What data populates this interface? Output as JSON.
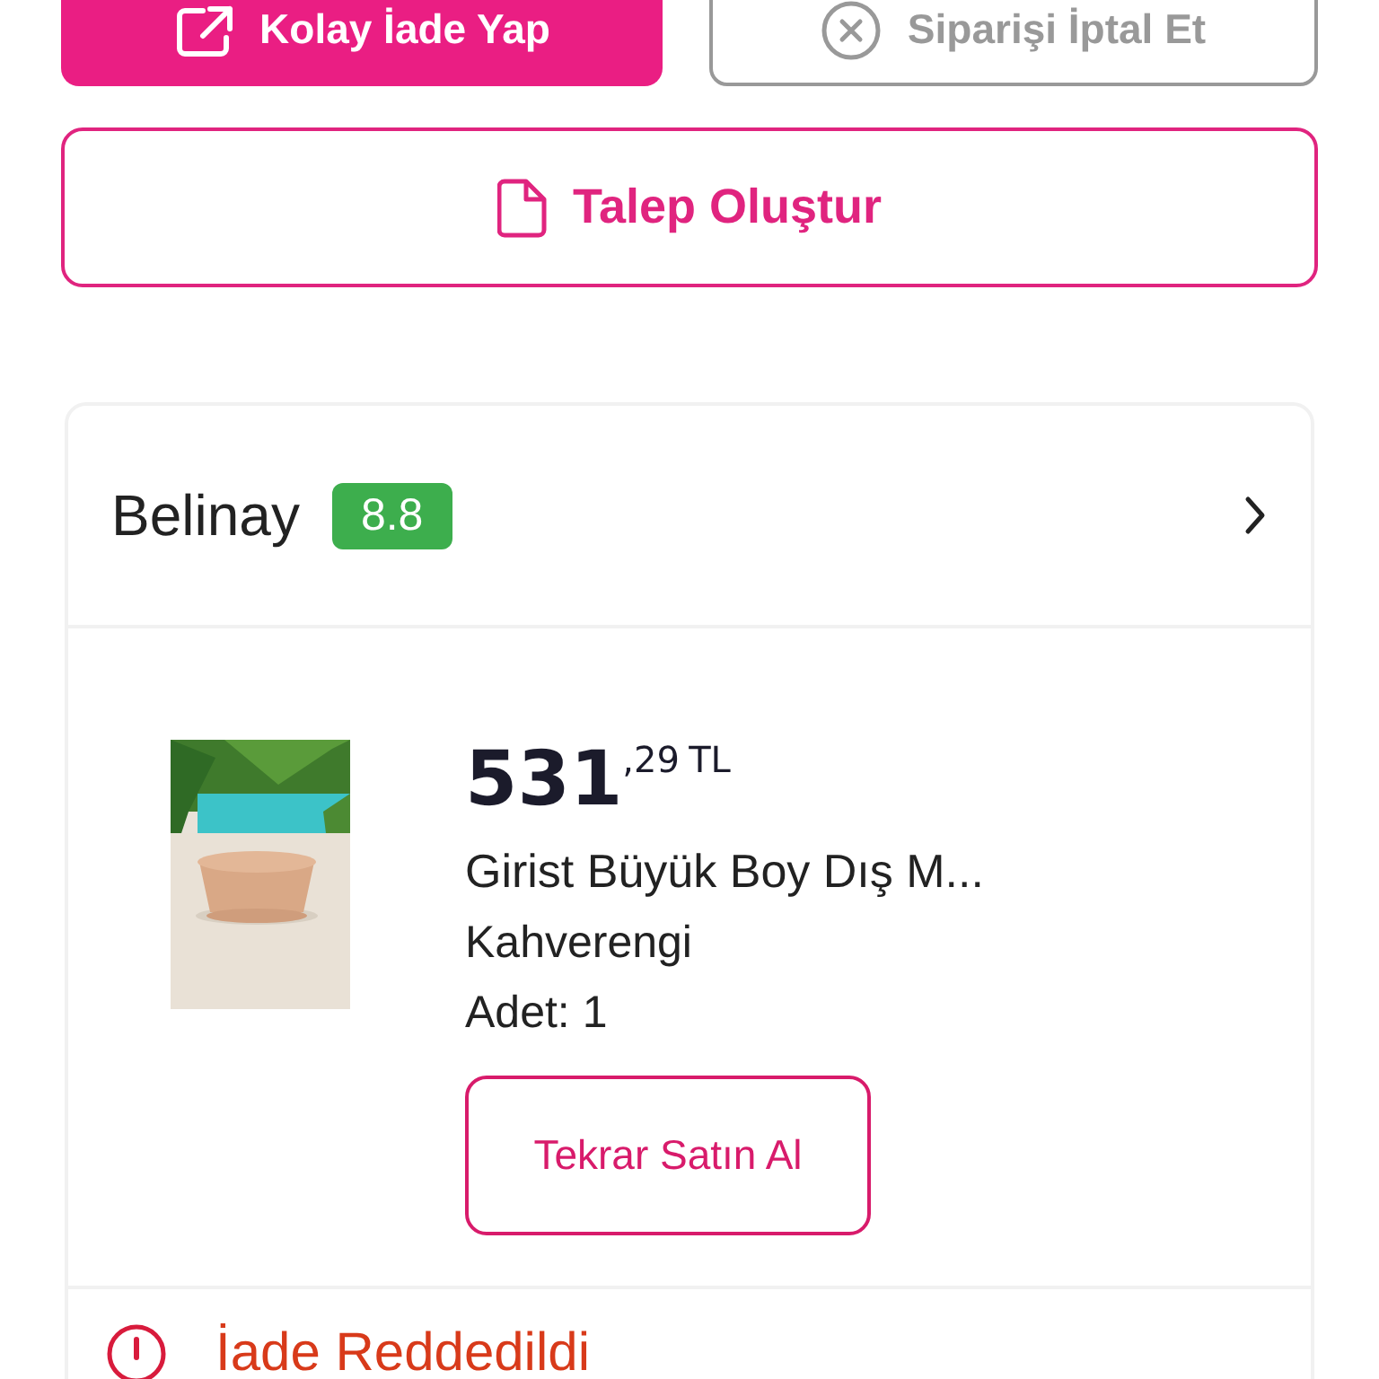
{
  "actions": [
    {
      "kind": "primary",
      "label": "Kolay İade Yap"
    },
    {
      "kind": "secondary",
      "label": "Siparişi İptal Et"
    }
  ],
  "request_button": {
    "label": "Talep Oluştur"
  },
  "seller": {
    "name": "Belinay",
    "rating": "8.8"
  },
  "product": {
    "kind": "picture",
    "price_whole": "531",
    "price_fraction": ",29",
    "currency": "TL",
    "title": "Girist Büyük Boy Dış M...",
    "variant": "Kahverengi",
    "quantity": "Adet: 1",
    "rebuy_button": "Tekrar Satın Al"
  },
  "status": {
    "kind": "rejected",
    "label": "İade Reddedildi"
  }
}
